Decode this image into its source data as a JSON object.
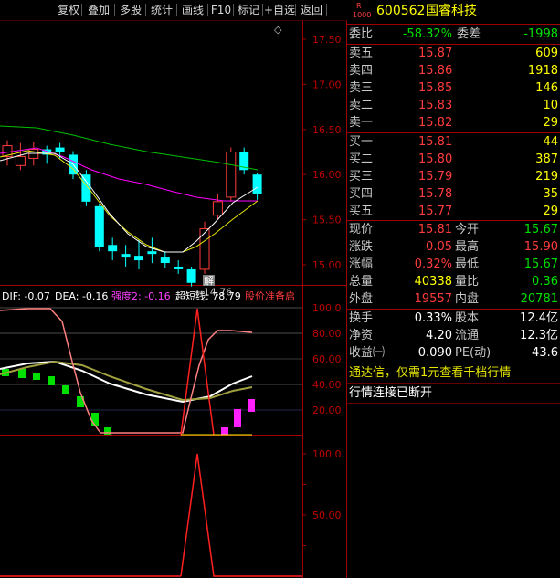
{
  "toolbar": {
    "buttons": [
      "复权",
      "叠加",
      "多股",
      "统计",
      "画线",
      "F10",
      "标记",
      "+自选",
      "返回"
    ]
  },
  "main_chart": {
    "price_ticks": [
      "17.50",
      "17.00",
      "16.50",
      "16.00",
      "15.50",
      "15.00"
    ],
    "low_label": "14.76",
    "jie_label": "解",
    "candles": [
      {
        "o": 16.2,
        "c": 16.32,
        "h": 16.38,
        "l": 16.1
      },
      {
        "o": 16.1,
        "c": 16.2,
        "h": 16.35,
        "l": 16.05
      },
      {
        "o": 16.18,
        "c": 16.28,
        "h": 16.36,
        "l": 16.1
      },
      {
        "o": 16.28,
        "c": 16.22,
        "h": 16.32,
        "l": 16.12
      },
      {
        "o": 16.3,
        "c": 16.25,
        "h": 16.35,
        "l": 16.18
      },
      {
        "o": 16.22,
        "c": 16.0,
        "h": 16.26,
        "l": 15.95
      },
      {
        "o": 16.0,
        "c": 15.7,
        "h": 16.05,
        "l": 15.65
      },
      {
        "o": 15.65,
        "c": 15.2,
        "h": 15.68,
        "l": 15.15
      },
      {
        "o": 15.22,
        "c": 15.15,
        "h": 15.3,
        "l": 15.05
      },
      {
        "o": 15.12,
        "c": 15.08,
        "h": 15.22,
        "l": 14.98
      },
      {
        "o": 15.1,
        "c": 15.05,
        "h": 15.28,
        "l": 14.95
      },
      {
        "o": 15.15,
        "c": 15.12,
        "h": 15.3,
        "l": 15.02
      },
      {
        "o": 15.08,
        "c": 15.02,
        "h": 15.15,
        "l": 14.96
      },
      {
        "o": 14.98,
        "c": 14.95,
        "h": 15.05,
        "l": 14.9
      },
      {
        "o": 14.95,
        "c": 14.8,
        "h": 14.98,
        "l": 14.76
      },
      {
        "o": 14.95,
        "c": 15.4,
        "h": 15.48,
        "l": 14.9
      },
      {
        "o": 15.55,
        "c": 15.7,
        "h": 15.78,
        "l": 15.5
      },
      {
        "o": 15.75,
        "c": 16.25,
        "h": 16.3,
        "l": 15.7
      },
      {
        "o": 16.25,
        "c": 16.05,
        "h": 16.3,
        "l": 16.0
      },
      {
        "o": 16.0,
        "c": 15.78,
        "h": 16.02,
        "l": 15.72
      }
    ]
  },
  "indicator": {
    "dif_label": "DIF: -0.07",
    "dea_label": "DEA: -0.16",
    "qiang_label": "强度2: -0.16",
    "chao_label": "超短线: 78.79",
    "gu_label": "股价准备启",
    "ticks": [
      "100.0",
      "80.00",
      "60.00",
      "40.00",
      "20.00"
    ]
  },
  "bottom_panel": {
    "ticks": [
      "100.0",
      "50.00"
    ]
  },
  "quote": {
    "code_prefix": "R",
    "code_sub": "1000",
    "code": "600562",
    "name": "国睿科技",
    "weibi_label": "委比",
    "weibi_value": "-58.32%",
    "weicha_label": "委差",
    "weicha_value": "-1998",
    "asks": [
      {
        "label": "卖五",
        "price": "15.87",
        "vol": "609"
      },
      {
        "label": "卖四",
        "price": "15.86",
        "vol": "1918"
      },
      {
        "label": "卖三",
        "price": "15.85",
        "vol": "146"
      },
      {
        "label": "卖二",
        "price": "15.83",
        "vol": "10"
      },
      {
        "label": "卖一",
        "price": "15.82",
        "vol": "29"
      }
    ],
    "bids": [
      {
        "label": "买一",
        "price": "15.81",
        "vol": "44"
      },
      {
        "label": "买二",
        "price": "15.80",
        "vol": "387"
      },
      {
        "label": "买三",
        "price": "15.79",
        "vol": "219"
      },
      {
        "label": "买四",
        "price": "15.78",
        "vol": "35"
      },
      {
        "label": "买五",
        "price": "15.77",
        "vol": "29"
      }
    ],
    "stats": [
      {
        "l1": "现价",
        "v1": "15.81",
        "c1": "red",
        "l2": "今开",
        "v2": "15.67",
        "c2": "green"
      },
      {
        "l1": "涨跌",
        "v1": "0.05",
        "c1": "red",
        "l2": "最高",
        "v2": "15.90",
        "c2": "red"
      },
      {
        "l1": "涨幅",
        "v1": "0.32%",
        "c1": "red",
        "l2": "最低",
        "v2": "15.67",
        "c2": "green"
      },
      {
        "l1": "总量",
        "v1": "40338",
        "c1": "yellow",
        "l2": "量比",
        "v2": "0.36",
        "c2": "green"
      },
      {
        "l1": "外盘",
        "v1": "19557",
        "c1": "red",
        "l2": "内盘",
        "v2": "20781",
        "c2": "green"
      }
    ],
    "stats2": [
      {
        "l1": "换手",
        "v1": "0.33%",
        "l2": "股本",
        "v2": "12.4亿"
      },
      {
        "l1": "净资",
        "v1": "4.20",
        "l2": "流通",
        "v2": "12.3亿"
      },
      {
        "l1": "收益㈠",
        "v1": "0.090",
        "l2": "PE(动)",
        "v2": "43.6"
      }
    ],
    "promo": "通达信，仅需1元查看千档行情",
    "status": "行情连接已断开"
  },
  "colors": {
    "up": "#ff3c3c",
    "down": "#00ffff",
    "ma_green": "#00c000",
    "ma_magenta": "#ff00ff",
    "ma_white": "#ffffff",
    "ma_yellow": "#e6e600"
  }
}
